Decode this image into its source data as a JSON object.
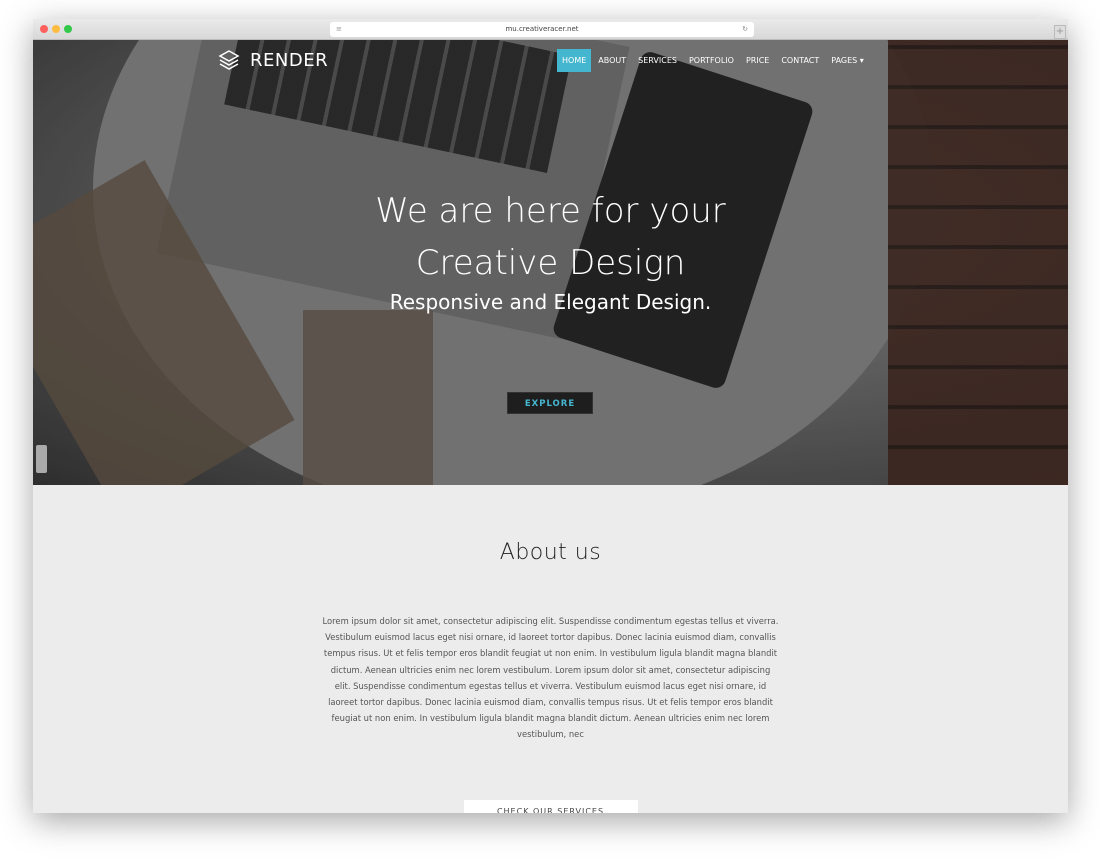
{
  "browser": {
    "url": "mu.creativeracer.net",
    "traffic_lights": [
      "#fc605c",
      "#fdbc40",
      "#34c84a"
    ]
  },
  "nav": {
    "brand": "RENDER",
    "items": [
      {
        "label": "HOME",
        "active": true
      },
      {
        "label": "ABOUT"
      },
      {
        "label": "SERVICES"
      },
      {
        "label": "PORTFOLIO"
      },
      {
        "label": "PRICE"
      },
      {
        "label": "CONTACT"
      },
      {
        "label": "PAGES ▾"
      }
    ],
    "accent": "#45b6cf"
  },
  "hero": {
    "title_line1": "We are here for your",
    "title_line2": "Creative Design",
    "subtitle": "Responsive and Elegant Design.",
    "cta": "EXPLORE"
  },
  "about": {
    "title": "About us",
    "body": "Lorem ipsum dolor sit amet, consectetur adipiscing elit. Suspendisse condimentum egestas tellus et viverra. Vestibulum euismod lacus eget nisi ornare, id laoreet tortor dapibus. Donec lacinia euismod diam, convallis tempus risus. Ut et felis tempor eros blandit feugiat ut non enim. In vestibulum ligula blandit magna blandit dictum. Aenean ultricies enim nec lorem vestibulum. Lorem ipsum dolor sit amet, consectetur adipiscing elit. Suspendisse condimentum egestas tellus et viverra. Vestibulum euismod lacus eget nisi ornare, id laoreet tortor dapibus. Donec lacinia euismod diam, convallis tempus risus. Ut et felis tempor eros blandit feugiat ut non enim. In vestibulum ligula blandit magna blandit dictum. Aenean ultricies enim nec lorem vestibulum, nec",
    "cta": "CHECK OUR SERVICES"
  }
}
